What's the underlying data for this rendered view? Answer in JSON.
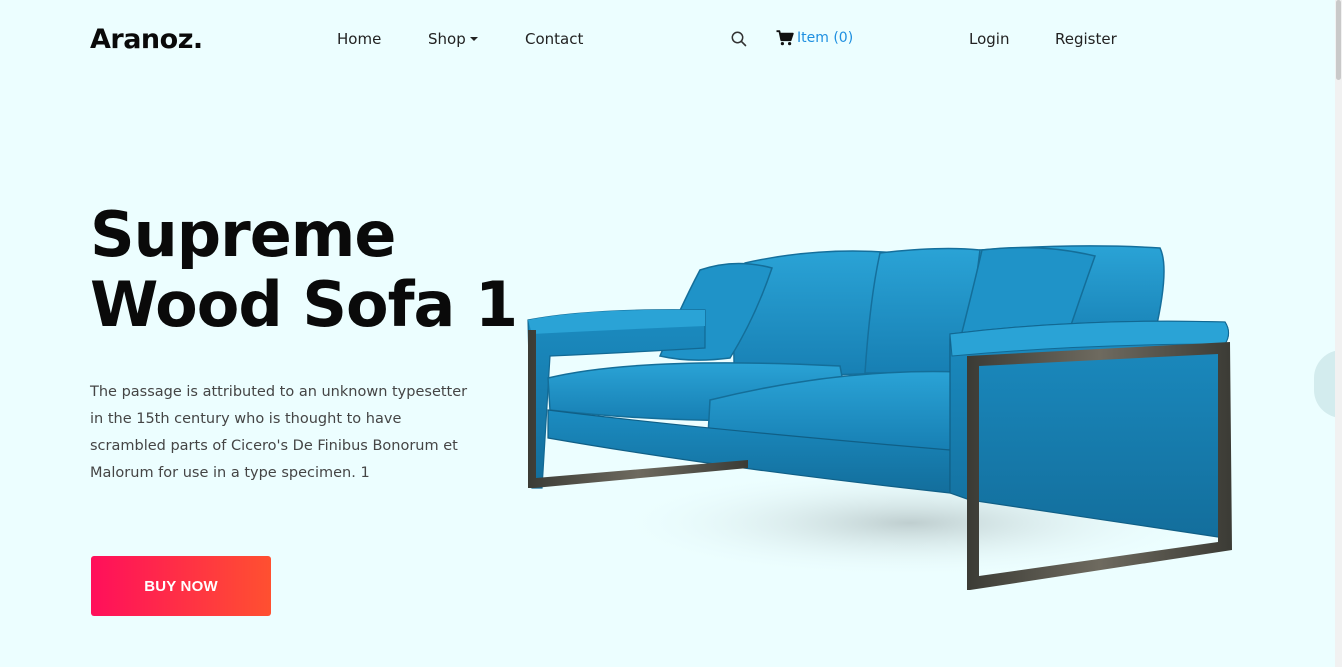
{
  "header": {
    "logo": "Aranoz.",
    "nav": {
      "home": "Home",
      "shop": "Shop",
      "contact": "Contact"
    },
    "search_icon": "search-icon",
    "cart": {
      "icon": "cart-icon",
      "label": "Item (0)"
    },
    "login": "Login",
    "register": "Register"
  },
  "hero": {
    "title_line1": "Supreme",
    "title_line2": "Wood Sofa 1",
    "description": "The passage is attributed to an unknown typesetter in the 15th century who is thought to have scrambled parts of Cicero's De Finibus Bonorum et Malorum for use in a type specimen. 1",
    "button": "BUY NOW",
    "product_image": "blue-sofa-image"
  },
  "colors": {
    "background": "#ecfeff",
    "accent_link": "#1e8fe0",
    "button_gradient_start": "#ff0f5b",
    "button_gradient_end": "#ff5030",
    "sofa_blue": "#1b8fc4"
  }
}
